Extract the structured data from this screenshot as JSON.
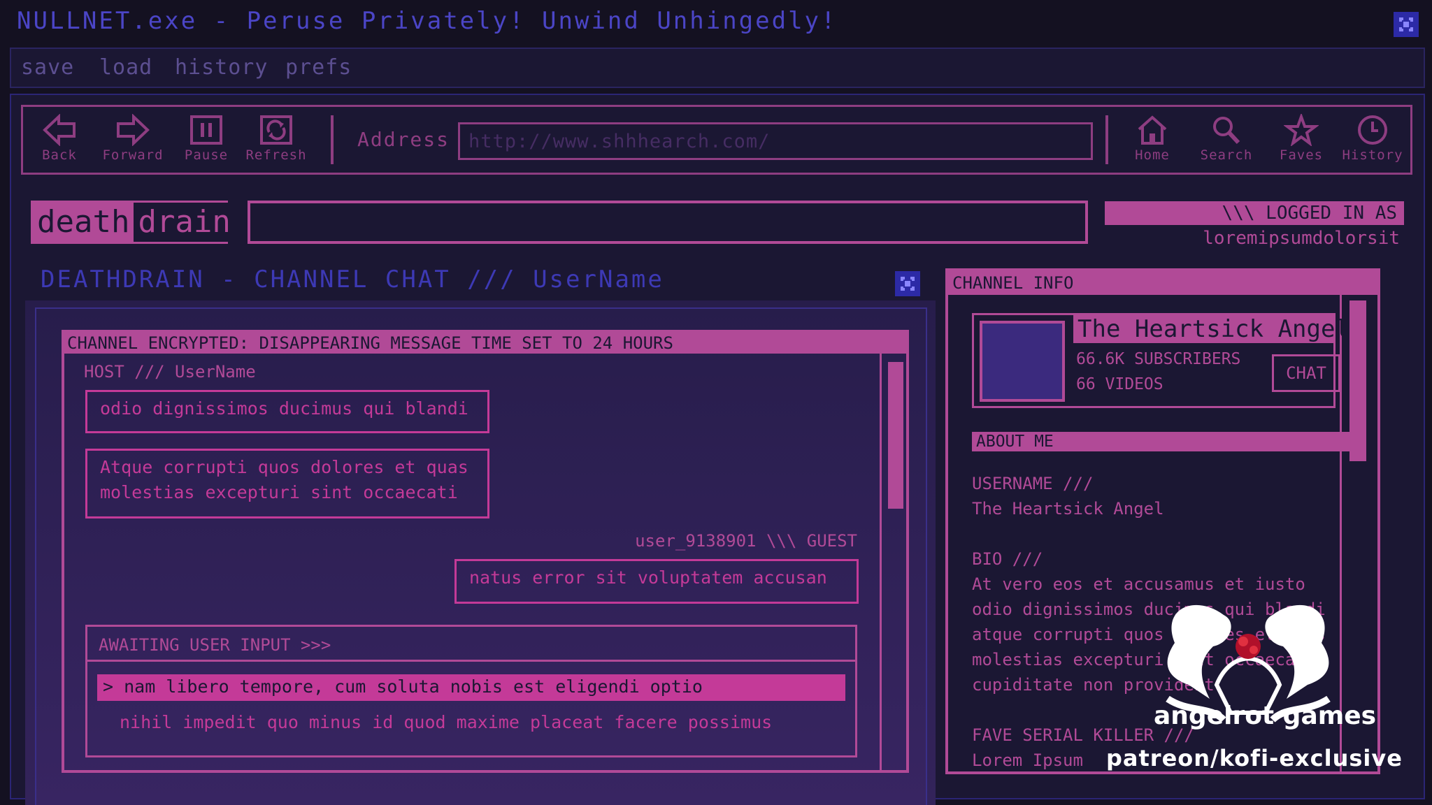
{
  "window": {
    "title": "NULLNET.exe - Peruse Privately! Unwind Unhingedly!"
  },
  "menu": {
    "items": [
      "save",
      "load",
      "history",
      "prefs"
    ]
  },
  "toolbar": {
    "back": "Back",
    "forward": "Forward",
    "pause": "Pause",
    "refresh": "Refresh",
    "address_label": "Address",
    "address_value": "http://www.shhhearch.com/",
    "home": "Home",
    "search": "Search",
    "faves": "Faves",
    "history": "History"
  },
  "site": {
    "logo_left": "death",
    "logo_right": "drain",
    "logged_in_label": "\\\\\\ LOGGED IN AS",
    "logged_in_user": "loremipsumdolorsit"
  },
  "chat": {
    "title": "DEATHDRAIN - CHANNEL CHAT /// UserName",
    "encryption_notice": "CHANNEL ENCRYPTED: DISAPPEARING MESSAGE TIME SET TO 24 HOURS",
    "host_label": "HOST /// UserName",
    "host_messages": [
      "odio dignissimos ducimus qui blandi",
      "Atque corrupti quos dolores et quas",
      "molestias excepturi sint occaecati"
    ],
    "guest_label": "user_9138901 \\\\\\ GUEST",
    "guest_message": "natus error sit voluptatem accusan",
    "await_label": "AWAITING USER INPUT >>>",
    "options": [
      "> nam libero tempore, cum soluta nobis est eligendi optio",
      "nihil impedit quo minus id quod maxime placeat facere possimus"
    ]
  },
  "channel_info": {
    "title": "CHANNEL INFO",
    "name": "The Heartsick Angel",
    "subscribers": "66.6K SUBSCRIBERS",
    "videos": "66 VIDEOS",
    "chat_button": "CHAT",
    "about_title": "ABOUT ME",
    "username_label": "USERNAME ///",
    "username_value": "The Heartsick Angel",
    "bio_label": "BIO ///",
    "bio_lines": [
      "At vero eos et accusamus et iusto",
      "odio dignissimos ducimus qui blandi",
      "atque corrupti quos dolores et quas",
      "molestias excepturi sint occaecati",
      "cupiditate non provident."
    ],
    "fave_label": "FAVE SERIAL KILLER ///",
    "fave_value": "Lorem Ipsum"
  },
  "watermark": {
    "brand": "angelrot games",
    "tagline": "patreon/kofi-exclusive"
  },
  "colors": {
    "bg": "#141121",
    "panel": "#1b1733",
    "accent": "#b14a97",
    "title_blue": "#4b45c6",
    "hot_pink": "#c43a98"
  }
}
